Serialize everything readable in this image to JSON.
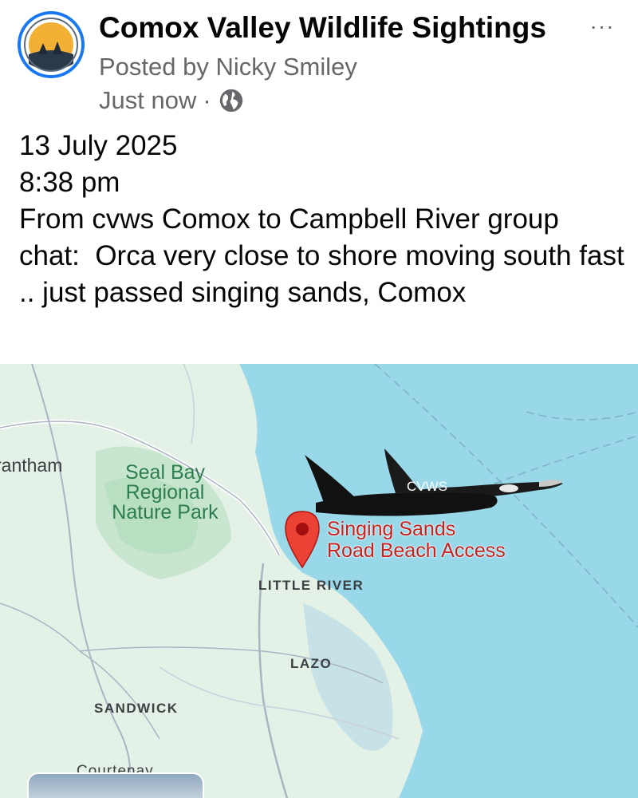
{
  "post": {
    "group_name": "Comox Valley Wildlife Sightings",
    "posted_by": "Posted by Nicky Smiley",
    "timestamp": "Just now",
    "separator": "·",
    "privacy_icon": "globe-icon",
    "more_icon": "ellipsis-icon",
    "more_label": "···"
  },
  "body": {
    "lines": [
      "13 July 2025",
      "8:38 pm",
      "From cvws Comox to Campbell River group chat:  Orca very close to shore moving south fast .. just passed singing sands, Comox"
    ]
  },
  "map": {
    "labels": {
      "grantham": "rantham",
      "park_line1": "Seal Bay",
      "park_line2": "Regional",
      "park_line3": "Nature Park",
      "place_line1": "Singing Sands",
      "place_line2": "Road Beach Access",
      "little_river": "LITTLE RIVER",
      "lazo": "LAZO",
      "sandwick": "SANDWICK",
      "courtenay": "Courtenay",
      "orca_tag": "CVWS"
    },
    "colors": {
      "water": "#98d8e9",
      "land": "#e3f1e7",
      "park": "#b8dfc1",
      "pin": "#ea4335",
      "place_label": "#c5221f"
    }
  },
  "theme": {
    "accent": "#1877f2",
    "secondary_text": "#65676b"
  }
}
